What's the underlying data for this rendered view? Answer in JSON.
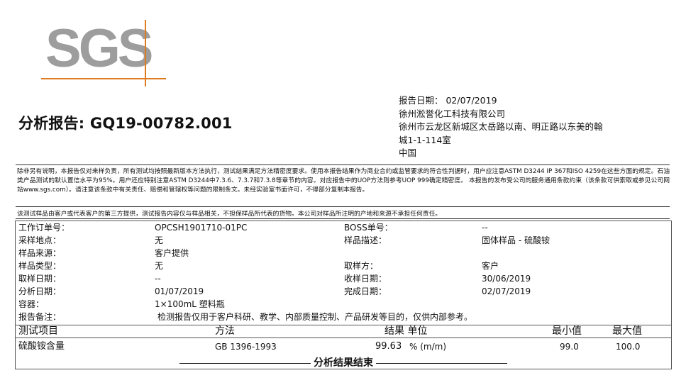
{
  "logo": {
    "text": "SGS"
  },
  "title": "分析报告: GQ19-00782.001",
  "address": {
    "report_date": "报告日期： 02/07/2019",
    "company": "徐州淞誉化工科技有限公司",
    "street1": "徐州市云龙区新城区太岳路以南、明正路以东美的翰",
    "street2": "城1-1-114室",
    "country": "中国"
  },
  "disclaimer": "除非另有说明，本报告仅对来样负责，所有测试均按照最新版本方法执行，测试结果满足方法精密度要求。使用本报告结果作为商业合约或监管要求的符合性判据时，用户应注意ASTM D3244 IP 367和ISO 4259在这些方面的规定。石油类产品测试的默认置信水平为95%。用户还应特别注意ASTM D3244中7.3.6、7.3.7和7.3.8等章节的内容。对应报告中的UOP方法则参考UOP 999确定精密度。 本报告的发布受公司的服务通用条款约束（该条款可供索取或参见公司网站www.sgs.com）。请注意该条款中有关责任、赔偿和管辖权等问题的限制条文。未经实验室书面许可，不得部分复制本报告。",
  "notice": "该测试样品由客户或代表客户的第三方提供，测试报告内容仅与样品相关，不担保样品所代表的货物。本公司对样品所注明的产地和来源不承担任何责任。",
  "info": [
    {
      "l1": "工作订单号：",
      "v1": "OPCSH1901710-01PC",
      "l2": "BOSS单号：",
      "v2": "--"
    },
    {
      "l1": "采样地点：",
      "v1": "无",
      "l2": "样品描述：",
      "v2": "固体样品 - 硫酸铵"
    },
    {
      "l1": "样品来源：",
      "v1": "客户提供",
      "l2": "",
      "v2": ""
    },
    {
      "l1": "样品类型：",
      "v1": "无",
      "l2": "取样方：",
      "v2": "客户"
    },
    {
      "l1": "取样日期：",
      "v1": "--",
      "l2": "收样日期：",
      "v2": "30/06/2019"
    },
    {
      "l1": "分析日期：",
      "v1": "01/07/2019",
      "l2": "完成日期：",
      "v2": "02/07/2019"
    },
    {
      "l1": "容器：",
      "v1": "1×100mL 塑料瓶",
      "l2": "",
      "v2": ""
    },
    {
      "l1": "报告备注：",
      "v1": "检测报告仅用于客户科研、教学、内部质量控制、产品研发等目的，仅供内部参考。",
      "l2": "",
      "v2": ""
    }
  ],
  "results": {
    "headers": {
      "item": "测试项目",
      "method": "方法",
      "result_unit": "结果 单位",
      "min": "最小值",
      "max": "最大值"
    },
    "row": {
      "item": "硫酸铵含量",
      "method": "GB 1396-1993",
      "result": "99.63",
      "unit": "% (m/m)",
      "min": "99.0",
      "max": "100.0"
    },
    "end": "分析结果结束"
  }
}
